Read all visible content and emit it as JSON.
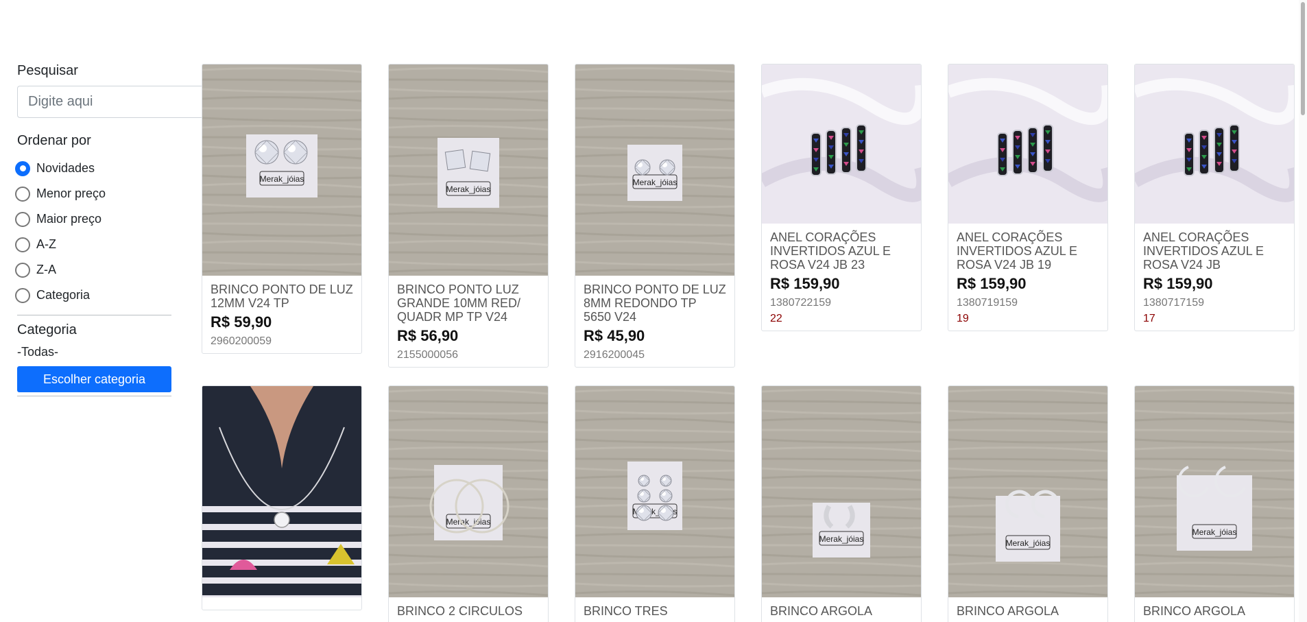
{
  "sidebar": {
    "search_label": "Pesquisar",
    "search_placeholder": "Digite aqui",
    "sort_label": "Ordenar por",
    "sort_options": [
      "Novidades",
      "Menor preço",
      "Maior preço",
      "A-Z",
      "Z-A",
      "Categoria"
    ],
    "sort_selected": "Novidades",
    "category_label": "Categoria",
    "category_value": "-Todas-",
    "category_button": "Escolher categoria"
  },
  "products": [
    {
      "title": "BRINCO PONTO DE LUZ 12MM V24 TP",
      "price": "R$ 59,90",
      "code": "2960200059",
      "stock": "",
      "image": "stud-earrings-round"
    },
    {
      "title": "BRINCO PONTO LUZ GRANDE 10MM RED/ QUADR MP TP V24",
      "price": "R$ 56,90",
      "code": "2155000056",
      "stock": "",
      "image": "stud-earrings-square"
    },
    {
      "title": "BRINCO PONTO DE LUZ 8MM REDONDO TP 5650 V24",
      "price": "R$ 45,90",
      "code": "2916200045",
      "stock": "",
      "image": "stud-earrings-small"
    },
    {
      "title": "ANEL CORAÇÕES INVERTIDOS AZUL E ROSA V24 JB 23",
      "price": "R$ 159,90",
      "code": "1380722159",
      "stock": "22",
      "image": "ring-hearts"
    },
    {
      "title": "ANEL CORAÇÕES INVERTIDOS AZUL E ROSA V24 JB 19",
      "price": "R$ 159,90",
      "code": "1380719159",
      "stock": "19",
      "image": "ring-hearts"
    },
    {
      "title": "ANEL CORAÇÕES INVERTIDOS AZUL E ROSA V24 JB",
      "price": "R$ 159,90",
      "code": "1380717159",
      "stock": "17",
      "image": "ring-hearts"
    },
    {
      "title": "",
      "price": "",
      "code": "",
      "stock": "",
      "image": "necklace-pendant"
    },
    {
      "title": "BRINCO 2 CIRCULOS",
      "price": "",
      "code": "",
      "stock": "",
      "image": "hoop-earrings-double"
    },
    {
      "title": "BRINCO TRES",
      "price": "",
      "code": "",
      "stock": "",
      "image": "drop-earrings"
    },
    {
      "title": "BRINCO ARGOLA",
      "price": "",
      "code": "",
      "stock": "",
      "image": "small-hoop-earrings"
    },
    {
      "title": "BRINCO ARGOLA",
      "price": "",
      "code": "",
      "stock": "",
      "image": "crescent-earrings"
    },
    {
      "title": "BRINCO ARGOLA",
      "price": "",
      "code": "",
      "stock": "",
      "image": "huggie-earrings"
    }
  ],
  "brand_tag": "Merak_jóias"
}
